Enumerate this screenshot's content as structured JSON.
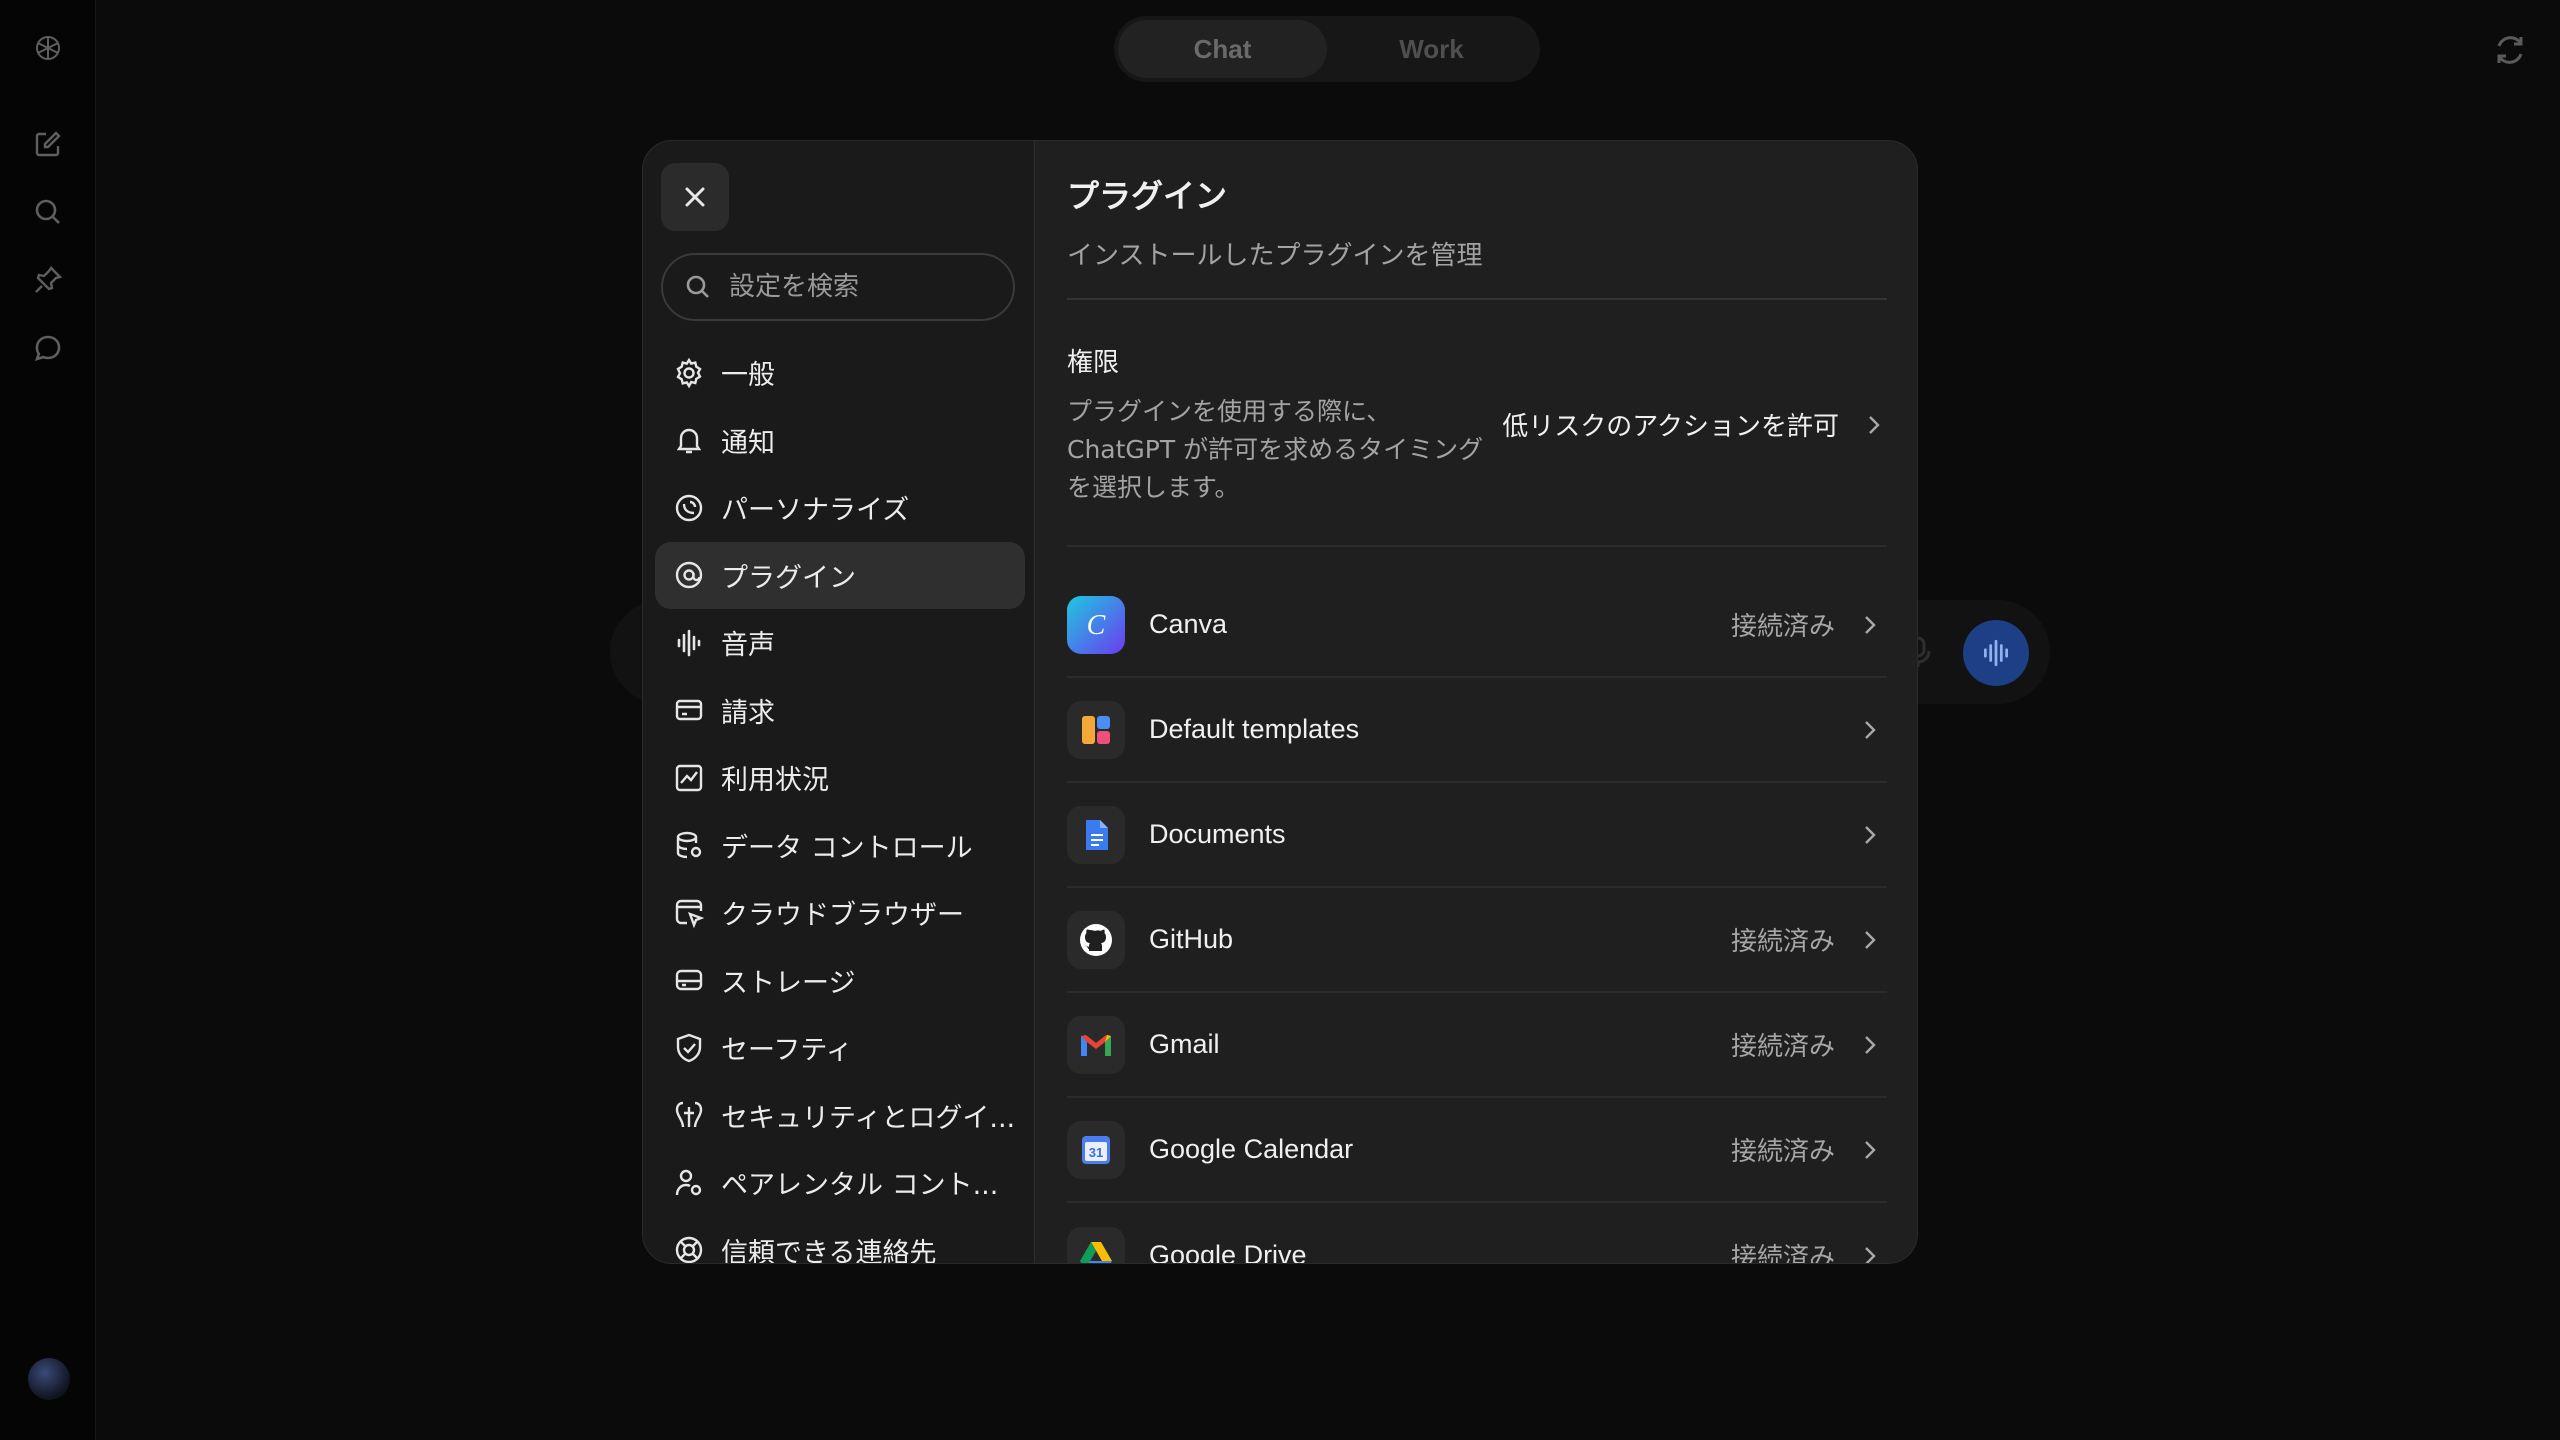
{
  "mode_toggle": {
    "chat": "Chat",
    "work": "Work"
  },
  "settings": {
    "search_placeholder": "設定を検索",
    "nav": [
      {
        "label": "一般",
        "icon": "gear-icon"
      },
      {
        "label": "通知",
        "icon": "bell-icon"
      },
      {
        "label": "パーソナライズ",
        "icon": "personalize-icon"
      },
      {
        "label": "プラグイン",
        "icon": "plugin-icon",
        "active": true
      },
      {
        "label": "音声",
        "icon": "waveform-icon"
      },
      {
        "label": "請求",
        "icon": "credit-card-icon"
      },
      {
        "label": "利用状況",
        "icon": "usage-chart-icon"
      },
      {
        "label": "データ コントロール",
        "icon": "database-icon"
      },
      {
        "label": "クラウドブラウザー",
        "icon": "cloud-browser-icon"
      },
      {
        "label": "ストレージ",
        "icon": "storage-icon"
      },
      {
        "label": "セーフティ",
        "icon": "shield-check-icon"
      },
      {
        "label": "セキュリティとログイ...",
        "icon": "security-icon"
      },
      {
        "label": "ペアレンタル コント...",
        "icon": "parental-icon"
      },
      {
        "label": "信頼できる連絡先",
        "icon": "lifebuoy-icon"
      }
    ]
  },
  "main": {
    "title": "プラグイン",
    "subtitle": "インストールしたプラグインを管理",
    "permission": {
      "title": "権限",
      "description": "プラグインを使用する際に、ChatGPT が許可を求めるタイミングを選択します。",
      "value": "低リスクのアクションを許可"
    },
    "plugins": [
      {
        "name": "Canva",
        "status": "接続済み",
        "icon": "canva-icon"
      },
      {
        "name": "Default templates",
        "status": "",
        "icon": "templates-icon"
      },
      {
        "name": "Documents",
        "status": "",
        "icon": "documents-icon"
      },
      {
        "name": "GitHub",
        "status": "接続済み",
        "icon": "github-icon"
      },
      {
        "name": "Gmail",
        "status": "接続済み",
        "icon": "gmail-icon"
      },
      {
        "name": "Google Calendar",
        "status": "接続済み",
        "icon": "google-calendar-icon"
      },
      {
        "name": "Google Drive",
        "status": "接続済み",
        "icon": "google-drive-icon"
      }
    ]
  },
  "colors": {
    "voice_button": "#1c3f86",
    "modal_bg": "#1f1f1f",
    "active_nav": "#2f2f2f"
  }
}
